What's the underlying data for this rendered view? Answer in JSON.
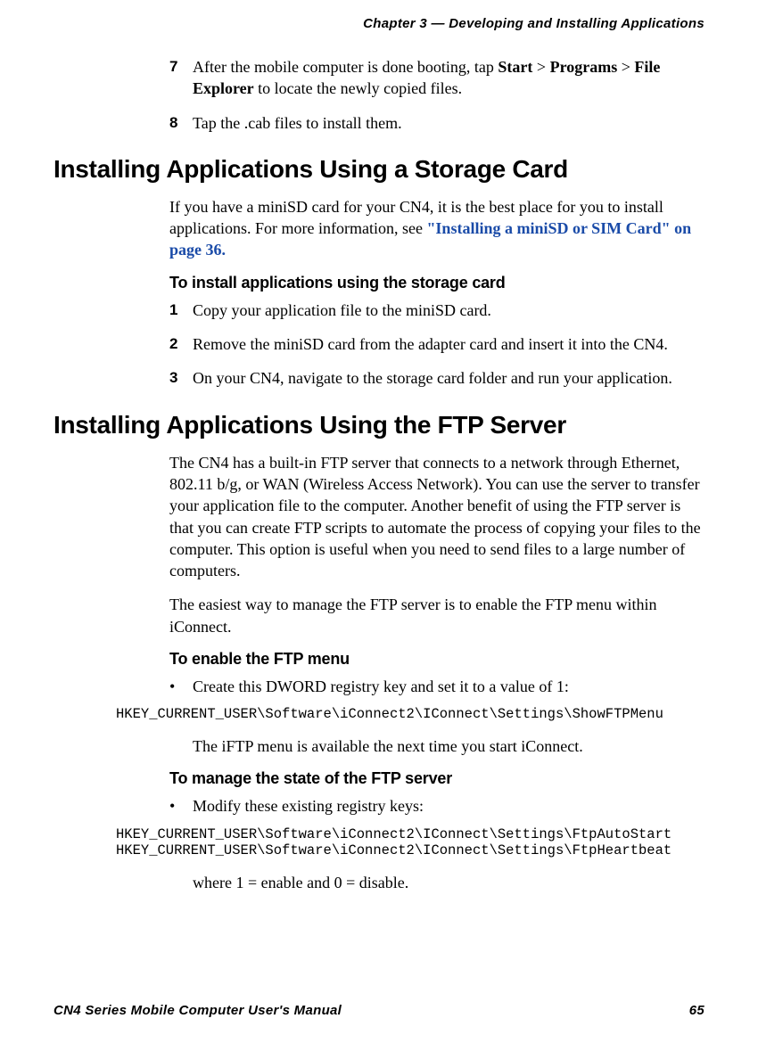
{
  "header": {
    "chapter": "Chapter 3 — Developing and Installing Applications"
  },
  "steps_a": {
    "n7": "7",
    "t7_pre": "After the mobile computer is done booting, tap ",
    "t7_b1": "Start",
    "t7_gt1": " > ",
    "t7_b2": "Programs",
    "t7_gt2": " > ",
    "t7_b3": "File Explorer",
    "t7_post": " to locate the newly copied files.",
    "n8": "8",
    "t8": "Tap the .cab files to install them."
  },
  "sec1": {
    "heading": "Installing Applications Using a Storage Card",
    "p1_pre": "If you have a miniSD card for your CN4, it is the best place for you to install applications. For more information, see ",
    "p1_link": "\"Installing a miniSD or SIM Card\" on page 36.",
    "sub1": "To install applications using the storage card",
    "n1": "1",
    "t1": "Copy your application file to the miniSD card.",
    "n2": "2",
    "t2": "Remove the miniSD card from the adapter card and insert it into the CN4.",
    "n3": "3",
    "t3": "On your CN4, navigate to the storage card folder and run your application."
  },
  "sec2": {
    "heading": "Installing Applications Using the FTP Server",
    "p1": "The CN4 has a built-in FTP server that connects to a network through Ethernet, 802.11 b/g, or WAN (Wireless Access Network). You can use the server to transfer your application file to the computer. Another benefit of using the FTP server is that you can create FTP scripts to automate the process of copying your files to the computer. This option is useful when you need to send files to a large number of computers.",
    "p2": "The easiest way to manage the FTP server is to enable the FTP menu within iConnect.",
    "sub1": "To enable the FTP menu",
    "b1": "Create this DWORD registry key and set it to a value of 1:",
    "code1": "HKEY_CURRENT_USER\\Software\\iConnect2\\IConnect\\Settings\\ShowFTPMenu",
    "p3": "The iFTP menu is available the next time you start iConnect.",
    "sub2": "To manage the state of the FTP server",
    "b2": "Modify these existing registry keys:",
    "code2": "HKEY_CURRENT_USER\\Software\\iConnect2\\IConnect\\Settings\\FtpAutoStart\nHKEY_CURRENT_USER\\Software\\iConnect2\\IConnect\\Settings\\FtpHeartbeat",
    "p4": "where 1 = enable and 0 = disable."
  },
  "footer": {
    "left": "CN4 Series Mobile Computer User's Manual",
    "right": "65"
  }
}
